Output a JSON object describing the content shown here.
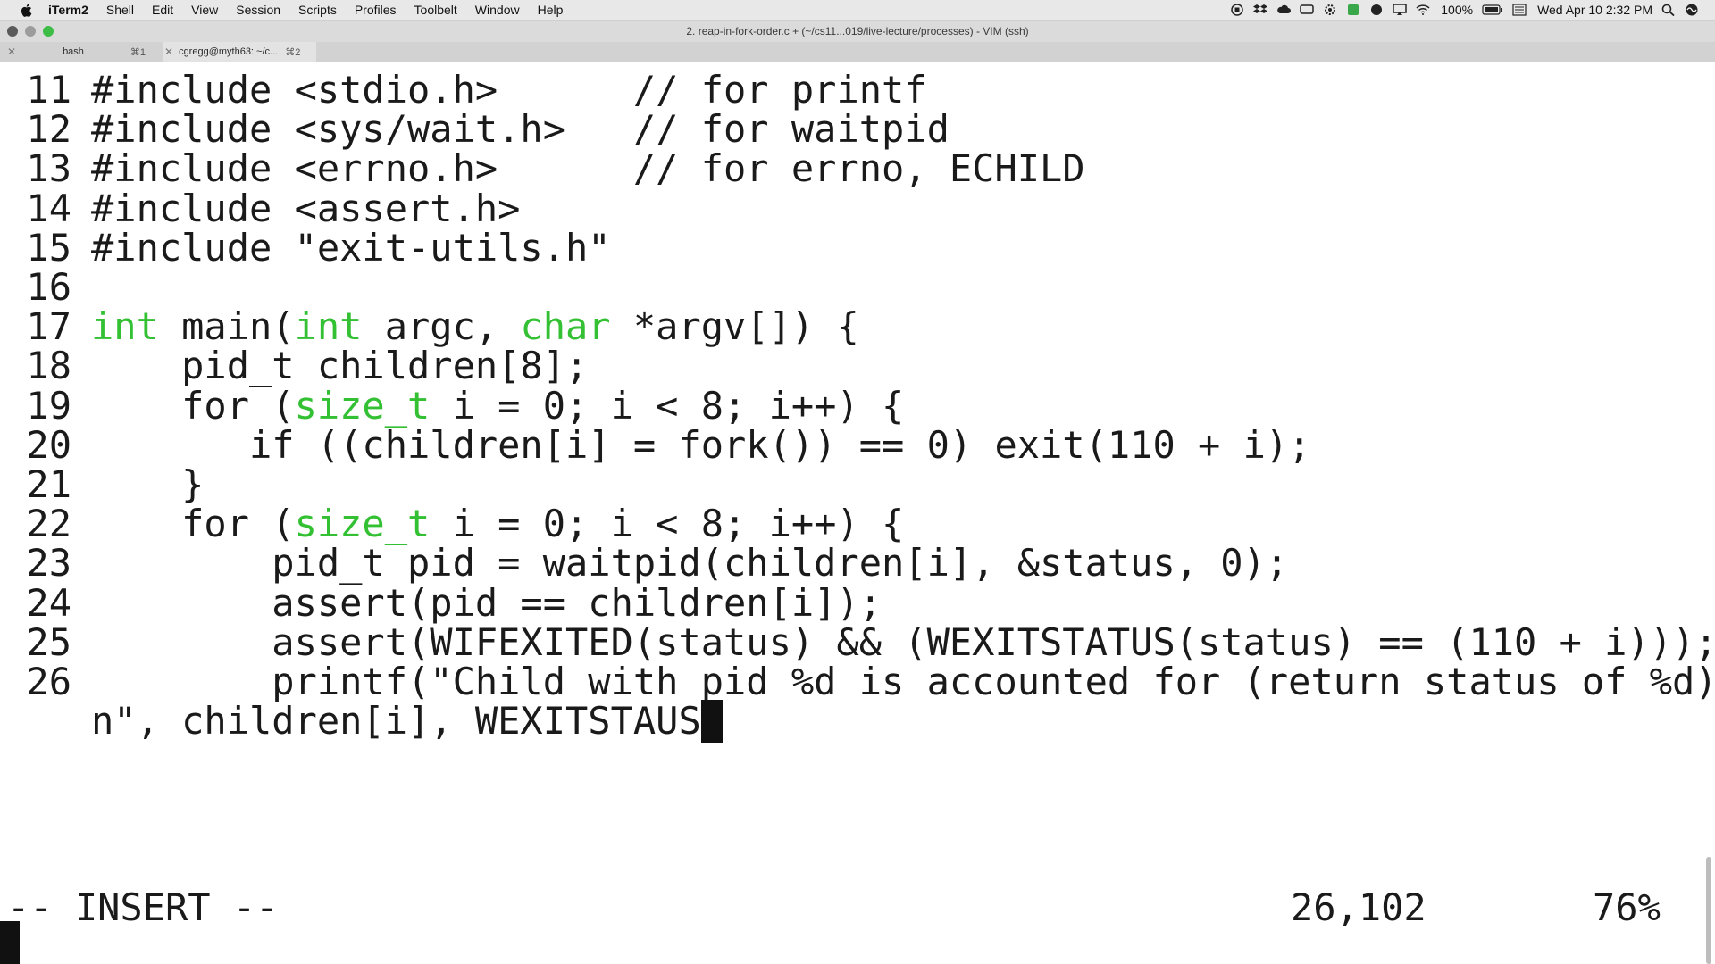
{
  "menubar": {
    "app_name": "iTerm2",
    "items": [
      "Shell",
      "Edit",
      "View",
      "Session",
      "Scripts",
      "Profiles",
      "Toolbelt",
      "Window",
      "Help"
    ],
    "battery": "100%",
    "datetime": "Wed Apr 10  2:32 PM",
    "icons": [
      "stop-icon",
      "dropbox-icon",
      "cloud-icon",
      "display-icon",
      "gear-icon",
      "evernote-icon",
      "record-icon",
      "airplay-icon",
      "wifi-icon",
      "battery-icon",
      "menu-icon",
      "search-icon",
      "siri-icon"
    ]
  },
  "window": {
    "title": "2. reap-in-fork-order.c + (~/cs11...019/live-lecture/processes) - VIM (ssh)"
  },
  "tabs": [
    {
      "label": "bash",
      "shortcut": "⌘1",
      "active": false
    },
    {
      "label": "cgregg@myth63: ~/c...",
      "shortcut": "⌘2",
      "active": true
    }
  ],
  "editor": {
    "lines": [
      {
        "num": "11",
        "text": "#include <stdio.h>      // for printf"
      },
      {
        "num": "12",
        "text": "#include <sys/wait.h>   // for waitpid"
      },
      {
        "num": "13",
        "text": "#include <errno.h>      // for errno, ECHILD"
      },
      {
        "num": "14",
        "text": "#include <assert.h>"
      },
      {
        "num": "15",
        "text": "#include \"exit-utils.h\""
      },
      {
        "num": "16",
        "text": ""
      },
      {
        "num": "17",
        "segments": [
          {
            "t": "int",
            "kw": true
          },
          {
            "t": " main(",
            "kw": false
          },
          {
            "t": "int",
            "kw": true
          },
          {
            "t": " argc, ",
            "kw": false
          },
          {
            "t": "char",
            "kw": true
          },
          {
            "t": " *argv[]) {",
            "kw": false
          }
        ]
      },
      {
        "num": "18",
        "text": "    pid_t children[8];"
      },
      {
        "num": "19",
        "segments": [
          {
            "t": "    for (",
            "kw": false
          },
          {
            "t": "size_t",
            "kw": true
          },
          {
            "t": " i = 0; i < 8; i++) {",
            "kw": false
          }
        ]
      },
      {
        "num": "20",
        "text": "       if ((children[i] = fork()) == 0) exit(110 + i);"
      },
      {
        "num": "21",
        "text": "    }"
      },
      {
        "num": "22",
        "segments": [
          {
            "t": "    for (",
            "kw": false
          },
          {
            "t": "size_t",
            "kw": true
          },
          {
            "t": " i = 0; i < 8; i++) {",
            "kw": false
          }
        ]
      },
      {
        "num": "23",
        "text": "        pid_t pid = waitpid(children[i], &status, 0);"
      },
      {
        "num": "24",
        "text": "        assert(pid == children[i]);"
      },
      {
        "num": "25",
        "text": "        assert(WIFEXITED(status) && (WEXITSTATUS(status) == (110 + i)));"
      },
      {
        "num": "26",
        "text": "        printf(\"Child with pid %d is accounted for (return status of %d).\\"
      },
      {
        "num": "",
        "text": "n\", children[i], WEXITSTAUS",
        "cursor": true
      }
    ],
    "keyword_color": "#33c033"
  },
  "statusline": {
    "mode": "-- INSERT --",
    "position": "26,102",
    "percent": "76%"
  }
}
